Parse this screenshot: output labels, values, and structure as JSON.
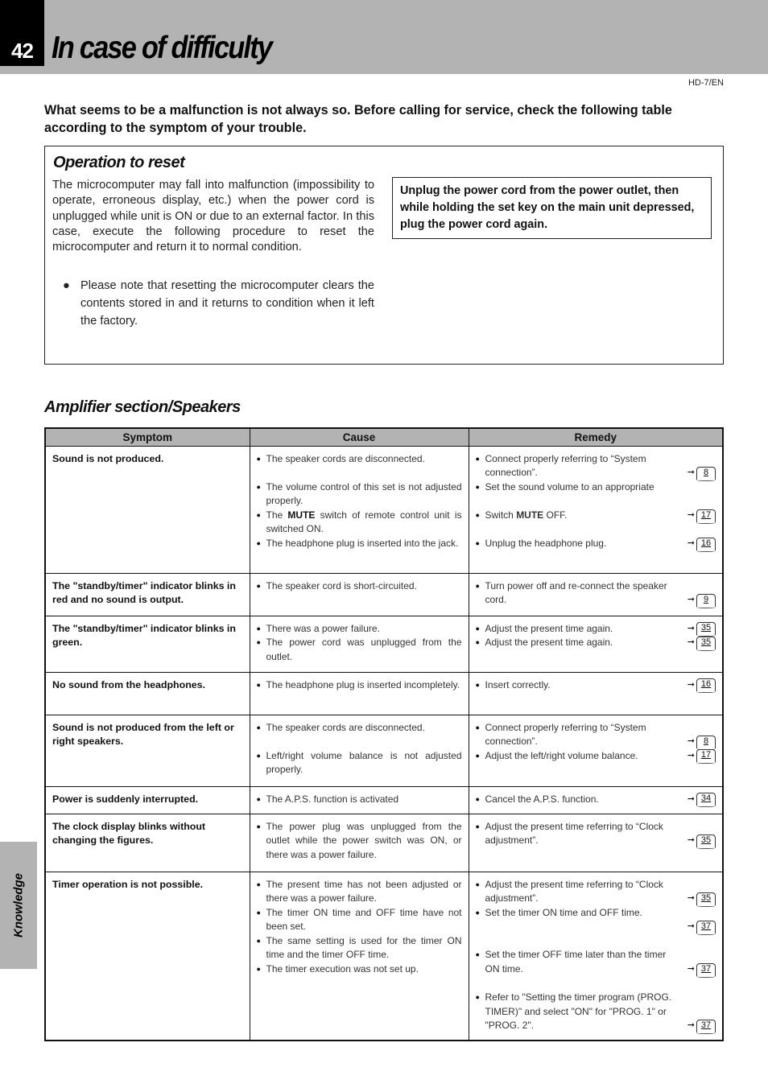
{
  "header": {
    "page_number": "42",
    "title": "In case of difficulty",
    "model_code": "HD-7/EN"
  },
  "intro": "What seems to be a malfunction is not always so.  Before calling for service, check the following table according to the symptom of your trouble.",
  "reset": {
    "title": "Operation to reset",
    "body": "The microcomputer may fall into malfunction (impossibility to operate, erroneous display, etc.) when the power cord is unplugged while unit is ON or due to an external factor. In this case, execute the following procedure to reset the microcomputer and return it to normal condition.",
    "note": "Please note that resetting the microcomputer clears the contents stored in and it returns to condition when it left the factory.",
    "instruction": "Unplug the power cord from the power outlet,  then while holding the set key on the main unit depressed, plug the  power cord again."
  },
  "section": {
    "title": "Amplifier section/Speakers",
    "side_tab": "Knowledge"
  },
  "table": {
    "headers": [
      "Symptom",
      "Cause",
      "Remedy"
    ],
    "rows": [
      {
        "symptom": "Sound is not produced.",
        "causes": [
          "The speaker cords are disconnected.",
          "The volume control of this set is not adjusted properly.",
          "The MUTE switch of remote control unit is switched ON.",
          "The headphone plug is inserted into the jack."
        ],
        "remedies": [
          {
            "text": "Connect properly referring to “System connection”.",
            "ref": "8"
          },
          {
            "text": "Set the sound volume to an appropriate",
            "ref": ""
          },
          {
            "text": "Switch MUTE OFF.",
            "ref": "17"
          },
          {
            "text": "Unplug the headphone plug.",
            "ref": "16"
          }
        ]
      },
      {
        "symptom": "The \"standby/timer\" indicator blinks in red and no sound is output.",
        "causes": [
          "The speaker cord is short-circuited."
        ],
        "remedies": [
          {
            "text": "Turn power off and re-connect the speaker cord.",
            "ref": "9"
          }
        ]
      },
      {
        "symptom": "The \"standby/timer\" indicator blinks in green.",
        "causes": [
          "There was a power failure.",
          "The power cord was unplugged from the outlet."
        ],
        "remedies": [
          {
            "text": "Adjust the present time again.",
            "ref": "35"
          },
          {
            "text": "Adjust the present time again.",
            "ref": "35"
          }
        ]
      },
      {
        "symptom": "No sound from the headphones.",
        "causes": [
          "The headphone plug is inserted incompletely."
        ],
        "remedies": [
          {
            "text": "Insert correctly.",
            "ref": "16"
          }
        ]
      },
      {
        "symptom": "Sound is not produced from the left or right speakers.",
        "causes": [
          "The speaker cords are disconnected.",
          "Left/right volume balance is not adjusted properly."
        ],
        "remedies": [
          {
            "text": "Connect properly referring to “System connection”.",
            "ref": "8"
          },
          {
            "text": "Adjust the left/right volume balance.",
            "ref": "17"
          }
        ]
      },
      {
        "symptom": "Power is suddenly interrupted.",
        "causes": [
          "The A.P.S. function is activated"
        ],
        "remedies": [
          {
            "text": "Cancel the A.P.S. function.",
            "ref": "34"
          }
        ]
      },
      {
        "symptom": "The clock display blinks without changing the figures.",
        "causes": [
          "The power plug was unplugged from the outlet while the power switch was ON, or there was a power failure."
        ],
        "remedies": [
          {
            "text": "Adjust the present time referring to “Clock adjustment”.",
            "ref": "35"
          }
        ]
      },
      {
        "symptom": "Timer operation is not possible.",
        "causes": [
          "The present time has not been adjusted or there was a power failure.",
          "The timer ON time and OFF time have not been set.",
          "The same setting is used for the timer ON time and the timer OFF time.",
          "The timer execution was not set up."
        ],
        "remedies": [
          {
            "text": "Adjust the present time referring to “Clock adjustment”.",
            "ref": "35"
          },
          {
            "text": "Set the timer ON time and OFF time.",
            "ref": "37"
          },
          {
            "text": "Set the timer OFF time later than the timer ON time.",
            "ref": "37"
          },
          {
            "text": "Refer to \"Setting the timer program (PROG. TIMER)\" and select \"ON\" for \"PROG. 1\" or \"PROG. 2\".",
            "ref": "37"
          }
        ]
      }
    ]
  }
}
